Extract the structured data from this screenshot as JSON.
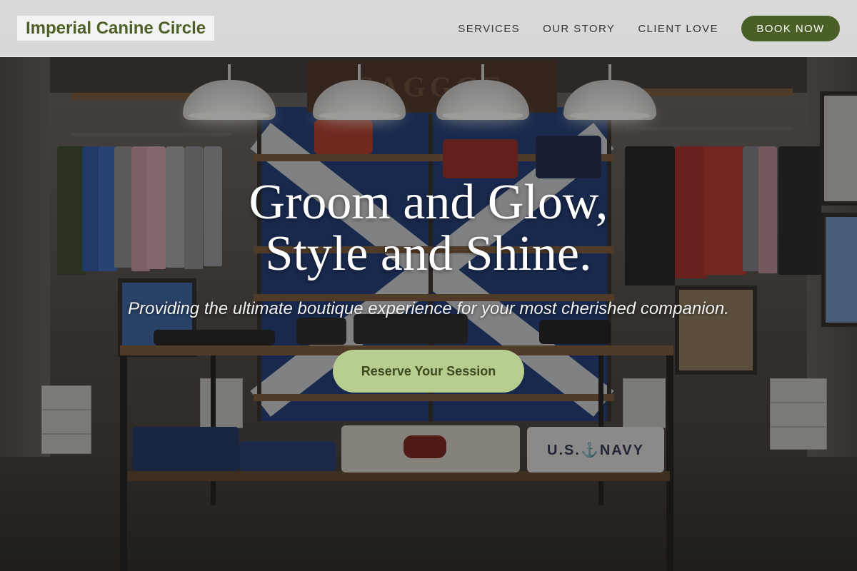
{
  "header": {
    "brand": "Imperial Canine Circle",
    "nav": [
      {
        "label": "SERVICES"
      },
      {
        "label": "OUR STORY"
      },
      {
        "label": "CLIENT LOVE"
      }
    ],
    "cta_label": "BOOK NOW"
  },
  "hero": {
    "title_line1": "Groom and Glow,",
    "title_line2": "Style and Shine.",
    "subtitle": "Providing the ultimate boutique experience for your most cherished companion.",
    "cta_label": "Reserve Your Session",
    "sign_text": "SAGGGE",
    "shirt_text": "U.S.⚓NAVY"
  },
  "colors": {
    "brand": "#4c6127",
    "book_button": "#4a5f25",
    "cta_button": "#b7cd8f",
    "cta_text": "#3b4b1f"
  }
}
